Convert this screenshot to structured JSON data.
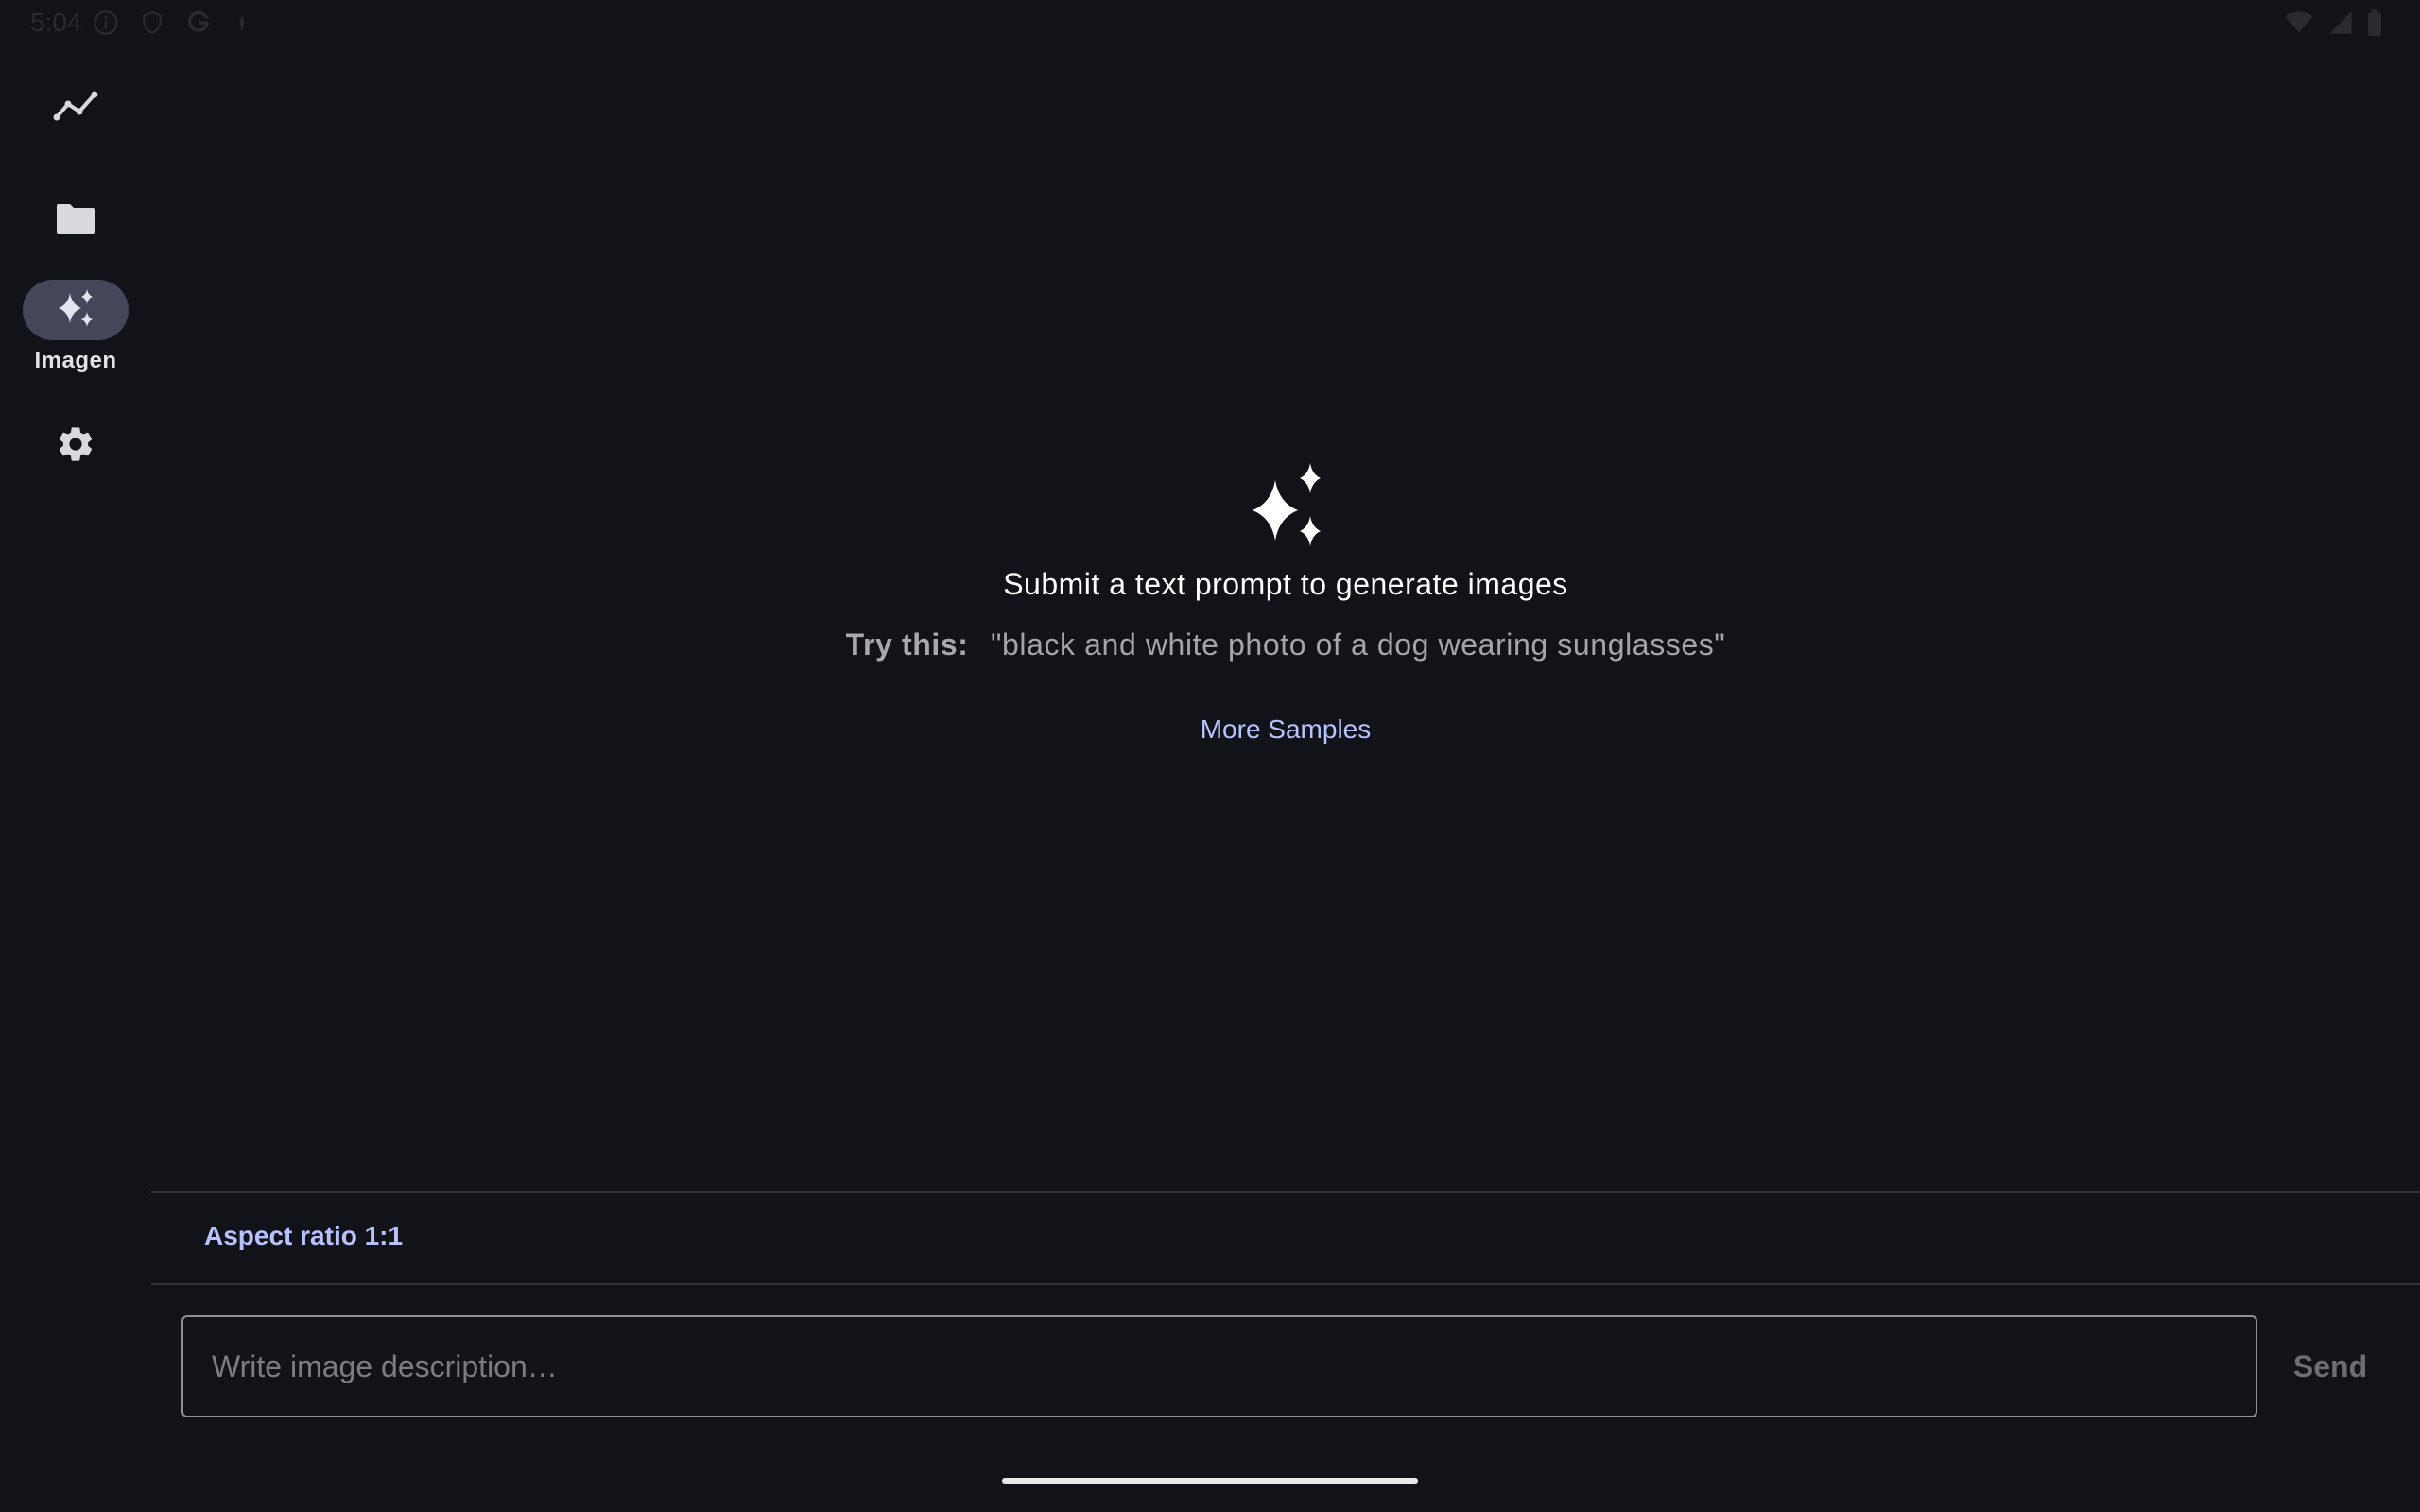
{
  "status_bar": {
    "time": "5:04",
    "left_icons": [
      "info-icon",
      "shield-icon",
      "google-icon",
      "sparkle-notification-icon"
    ],
    "right_icons": [
      "wifi-icon",
      "signal-icon",
      "battery-icon"
    ]
  },
  "nav_rail": {
    "items": [
      {
        "name": "trends",
        "icon": "trend-line-icon",
        "label": ""
      },
      {
        "name": "files",
        "icon": "folder-icon",
        "label": ""
      },
      {
        "name": "imagen",
        "icon": "sparkles-icon",
        "label": "Imagen",
        "selected": true
      },
      {
        "name": "settings",
        "icon": "gear-icon",
        "label": ""
      }
    ]
  },
  "empty_state": {
    "icon": "sparkles-icon",
    "headline": "Submit a text prompt to generate images",
    "try_label": "Try this:",
    "try_example": "\"black and white photo of a dog wearing sunglasses\"",
    "more_samples": "More Samples"
  },
  "options": {
    "aspect_ratio": "Aspect ratio 1:1"
  },
  "composer": {
    "placeholder": "Write image description…",
    "value": "",
    "send_label": "Send"
  },
  "colors": {
    "background": "#121318",
    "accent": "#b7c3ff",
    "rail_selected": "#444759",
    "divider": "#33343a"
  }
}
